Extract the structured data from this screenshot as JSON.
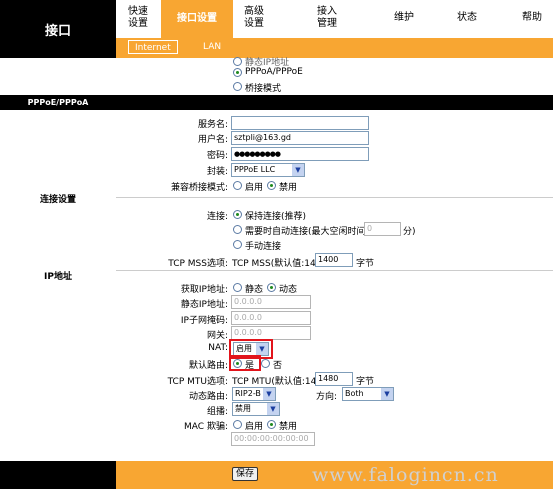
{
  "brand": "接口",
  "nav": [
    {
      "label": "快速\n设置"
    },
    {
      "label": "接口设置"
    },
    {
      "label": "高级\n设置"
    },
    {
      "label": "接入\n管理"
    },
    {
      "label": "维护"
    },
    {
      "label": "状态"
    },
    {
      "label": "帮助"
    }
  ],
  "subnav": {
    "internet": "Internet",
    "lan": "LAN"
  },
  "top_modes": {
    "partial": "静态IP地址",
    "pppoe": "PPPoA/PPPoE",
    "bridge": "桥接模式"
  },
  "section": {
    "pppoe": "PPPoE/PPPoA",
    "connection": "连接设置",
    "ip": "IP地址"
  },
  "pppoe": {
    "service_label": "服务名:",
    "service_value": "",
    "username_label": "用户名:",
    "username_value": "sztpli@163.gd",
    "password_label": "密码:",
    "password_value": "●●●●●●●●●",
    "encap_label": "封装:",
    "encap_value": "PPPoE LLC",
    "bridge_compat_label": "兼容桥接模式:",
    "enable": "启用",
    "disable": "禁用"
  },
  "connection": {
    "label": "连接:",
    "keep_alive": "保持连接(推荐)",
    "on_demand": "需要时自动连接(最大空闲时间",
    "idle_value": "0",
    "minutes": "分)",
    "manual": "手动连接",
    "mss_label": "TCP MSS选项:",
    "mss_text": "TCP MSS(默认值:1400)",
    "mss_value": "1400",
    "mss_unit": "字节"
  },
  "ip": {
    "get_ip_label": "获取IP地址:",
    "static": "静态",
    "dynamic": "动态",
    "static_ip_label": "静态IP地址:",
    "static_ip_value": "0.0.0.0",
    "mask_label": "IP子网掩码:",
    "mask_value": "0.0.0.0",
    "gateway_label": "网关:",
    "gateway_value": "0.0.0.0",
    "nat_label": "NAT:",
    "nat_value": "启用",
    "default_route_label": "默认路由:",
    "yes": "是",
    "no": "否",
    "mtu_label": "TCP MTU选项:",
    "mtu_text": "TCP MTU(默认值:1480)",
    "mtu_value": "1480",
    "mtu_unit": "字节",
    "dynamic_route_label": "动态路由:",
    "dynamic_route_value": "RIP2-B",
    "direction_label": "方向:",
    "direction_value": "Both",
    "multicast_label": "组播:",
    "multicast_value": "禁用",
    "mac_label": "MAC 欺骗:",
    "mac_enable": "启用",
    "mac_disable": "禁用",
    "mac_value": "00:00:00:00:00:00"
  },
  "footer": {
    "save": "保存"
  },
  "watermark": "www.falogincn.cn",
  "colors": {
    "accent": "#f8a632",
    "highlight": "#e2141b",
    "dark": "#000000"
  }
}
